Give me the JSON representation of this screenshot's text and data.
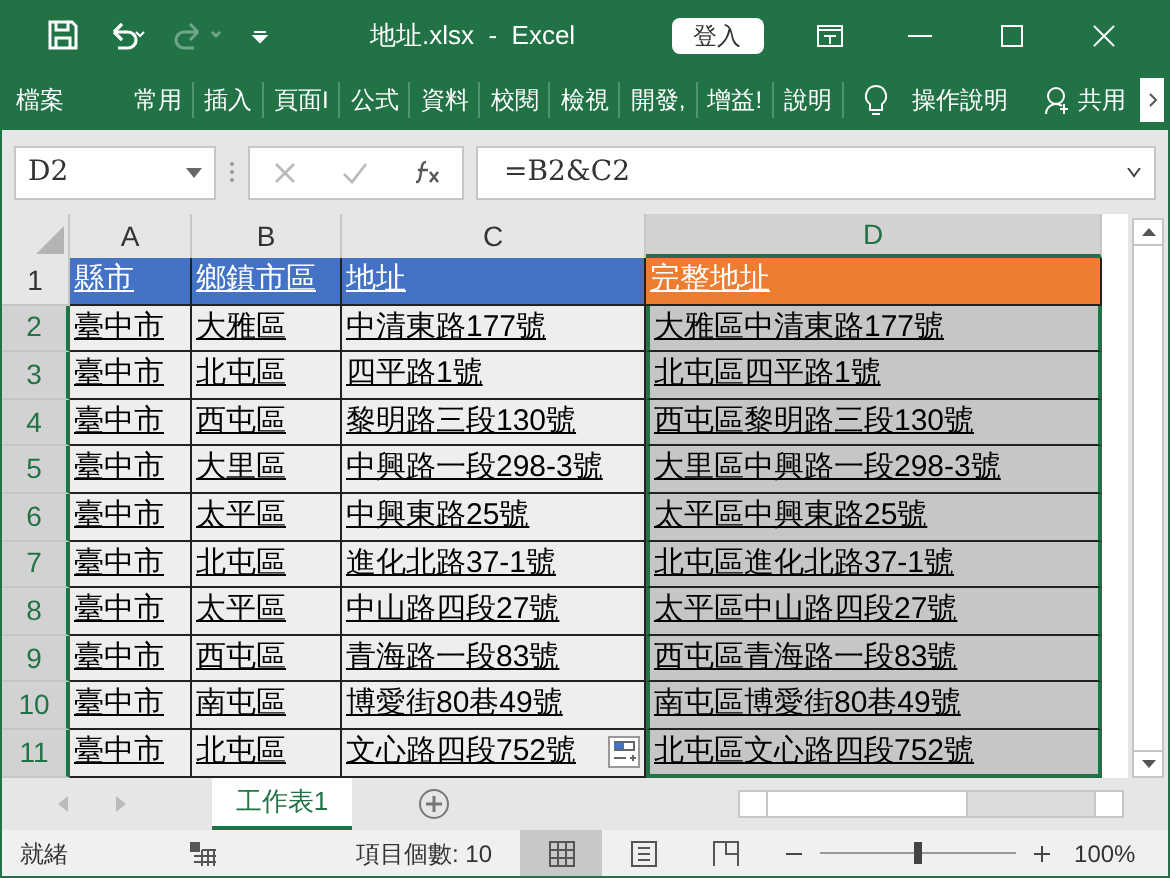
{
  "window": {
    "title": "地址.xlsx  -  Excel",
    "sign_in": "登入"
  },
  "ribbon": {
    "file": "檔案",
    "tabs": [
      "常用",
      "插入",
      "頁面I",
      "公式",
      "資料",
      "校閱",
      "檢視",
      "開發,",
      "增益!",
      "說明"
    ],
    "tell_me": "操作說明",
    "share": "共用"
  },
  "formula_bar": {
    "name_box": "D2",
    "formula": "=B2&C2"
  },
  "columns": [
    {
      "label": "A",
      "selected": false
    },
    {
      "label": "B",
      "selected": false
    },
    {
      "label": "C",
      "selected": false
    },
    {
      "label": "D",
      "selected": true
    }
  ],
  "header_row": {
    "number": "1",
    "cells": [
      {
        "text": "縣市",
        "color": "#4472c4"
      },
      {
        "text": "鄉鎮市區",
        "color": "#4472c4"
      },
      {
        "text": "地址",
        "color": "#4472c4"
      },
      {
        "text": "完整地址",
        "color": "#ed7d31"
      }
    ]
  },
  "rows": [
    {
      "number": "2",
      "cells": [
        "臺中市",
        "大雅區",
        "中清東路177號",
        "大雅區中清東路177號"
      ]
    },
    {
      "number": "3",
      "cells": [
        "臺中市",
        "北屯區",
        "四平路1號",
        "北屯區四平路1號"
      ]
    },
    {
      "number": "4",
      "cells": [
        "臺中市",
        "西屯區",
        "黎明路三段130號",
        "西屯區黎明路三段130號"
      ]
    },
    {
      "number": "5",
      "cells": [
        "臺中市",
        "大里區",
        "中興路一段298-3號",
        "大里區中興路一段298-3號"
      ]
    },
    {
      "number": "6",
      "cells": [
        "臺中市",
        "太平區",
        "中興東路25號",
        "太平區中興東路25號"
      ]
    },
    {
      "number": "7",
      "cells": [
        "臺中市",
        "北屯區",
        "進化北路37-1號",
        "北屯區進化北路37-1號"
      ]
    },
    {
      "number": "8",
      "cells": [
        "臺中市",
        "太平區",
        "中山路四段27號",
        "太平區中山路四段27號"
      ]
    },
    {
      "number": "9",
      "cells": [
        "臺中市",
        "西屯區",
        "青海路一段83號",
        "西屯區青海路一段83號"
      ]
    },
    {
      "number": "10",
      "cells": [
        "臺中市",
        "南屯區",
        "博愛街80巷49號",
        "南屯區博愛街80巷49號"
      ]
    },
    {
      "number": "11",
      "cells": [
        "臺中市",
        "北屯區",
        "文心路四段752號",
        "北屯區文心路四段752號"
      ]
    }
  ],
  "sheet_tabs": [
    {
      "label": "工作表1",
      "selected": true
    }
  ],
  "status_bar": {
    "ready": "就緒",
    "count": "項目個數: 10",
    "views": [
      {
        "kind": "normal",
        "selected": true
      },
      {
        "kind": "page_layout",
        "selected": false
      },
      {
        "kind": "page_break",
        "selected": false
      }
    ],
    "zoom": {
      "level": 0.5,
      "reading": "100%"
    }
  }
}
